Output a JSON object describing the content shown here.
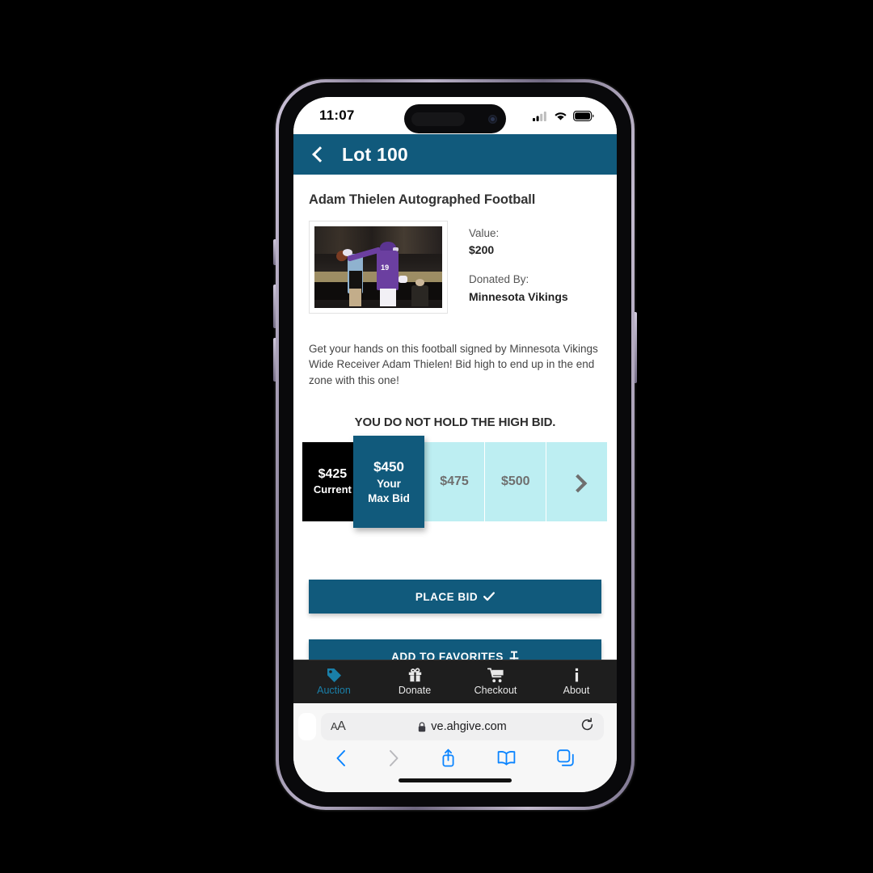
{
  "status_bar": {
    "time": "11:07",
    "signal_icon": "cellular-signal-icon",
    "wifi_icon": "wifi-icon",
    "battery_icon": "battery-icon"
  },
  "app_header": {
    "back_icon": "back-chevron-icon",
    "title": "Lot 100",
    "background_color": "#115a7c"
  },
  "item": {
    "title": "Adam Thielen Autographed Football",
    "image_alt": "minnesota-vikings-player-pointing",
    "value_label": "Value:",
    "value": "$200",
    "donated_by_label": "Donated By:",
    "donated_by": "Minnesota Vikings",
    "description": "Get your hands on this football signed by Minnesota Vikings Wide Receiver Adam Thielen! Bid high to end up in the end zone with this one!"
  },
  "bidding": {
    "status_message": "YOU DO NOT HOLD THE HIGH BID.",
    "current": {
      "amount": "$425",
      "label": "Current"
    },
    "my_bid": {
      "amount": "$450",
      "label_line1": "Your",
      "label_line2": "Max Bid"
    },
    "options": [
      {
        "amount": "$475"
      },
      {
        "amount": "$500"
      }
    ],
    "next_icon": "chevron-right-icon",
    "highlight_color": "#115a7c",
    "tile_color": "#bdeef2",
    "current_color": "#000000"
  },
  "actions": {
    "place_bid_label": "PLACE BID",
    "place_bid_icon": "checkmark-icon",
    "favorites_label": "ADD TO FAVORITES",
    "favorites_icon": "pin-icon"
  },
  "tabbar": {
    "items": [
      {
        "label": "Auction",
        "icon": "tag-icon",
        "active": true
      },
      {
        "label": "Donate",
        "icon": "gift-icon",
        "active": false
      },
      {
        "label": "Checkout",
        "icon": "cart-icon",
        "active": false
      },
      {
        "label": "About",
        "icon": "info-icon",
        "active": false
      }
    ],
    "active_color": "#1a7fa8"
  },
  "browser": {
    "text_size_label": "AA",
    "lock_icon": "lock-icon",
    "url": "ve.ahgive.com",
    "reload_icon": "reload-icon",
    "back_icon": "browser-back-icon",
    "forward_icon": "browser-forward-icon",
    "share_icon": "share-icon",
    "bookmarks_icon": "book-icon",
    "tabs_icon": "tabs-icon"
  }
}
